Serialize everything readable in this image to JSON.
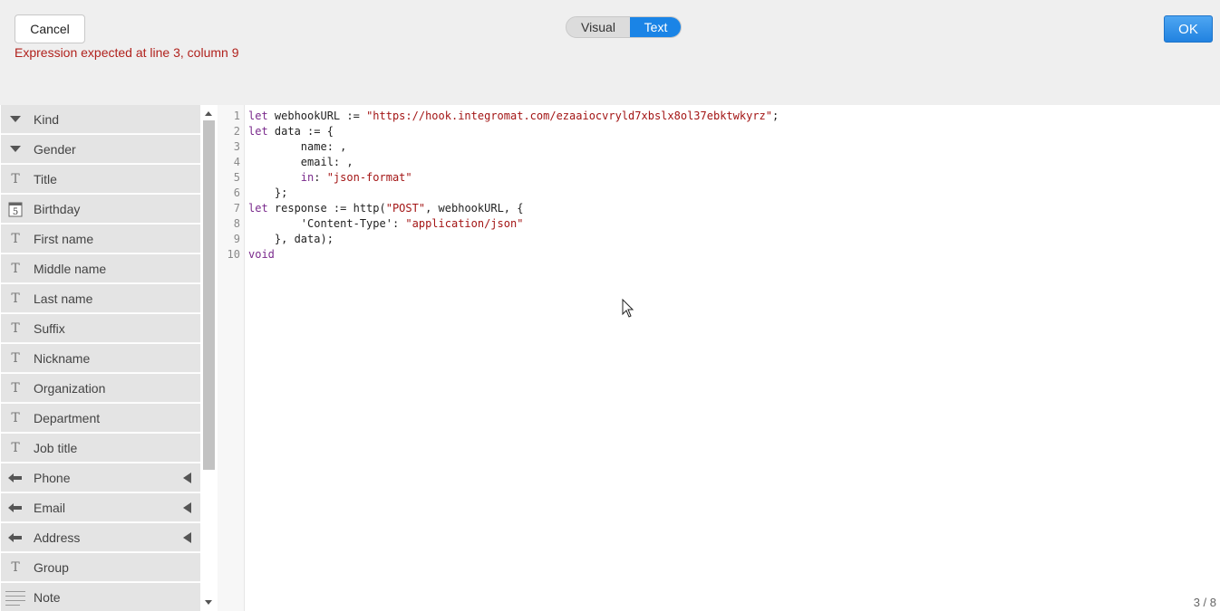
{
  "header": {
    "cancel_label": "Cancel",
    "error_message": "Expression expected at line 3, column 9",
    "toggle": {
      "visual_label": "Visual",
      "text_label": "Text",
      "active": "Text"
    },
    "ok_label": "OK"
  },
  "sidebar": {
    "items": [
      {
        "label": "Kind",
        "icon": "dropdown-icon"
      },
      {
        "label": "Gender",
        "icon": "dropdown-icon"
      },
      {
        "label": "Title",
        "icon": "text-icon"
      },
      {
        "label": "Birthday",
        "icon": "calendar-icon",
        "icon_text": "5"
      },
      {
        "label": "First name",
        "icon": "text-icon"
      },
      {
        "label": "Middle name",
        "icon": "text-icon"
      },
      {
        "label": "Last name",
        "icon": "text-icon"
      },
      {
        "label": "Suffix",
        "icon": "text-icon"
      },
      {
        "label": "Nickname",
        "icon": "text-icon"
      },
      {
        "label": "Organization",
        "icon": "text-icon"
      },
      {
        "label": "Department",
        "icon": "text-icon"
      },
      {
        "label": "Job title",
        "icon": "text-icon"
      },
      {
        "label": "Phone",
        "icon": "list-icon"
      },
      {
        "label": "Email",
        "icon": "list-icon"
      },
      {
        "label": "Address",
        "icon": "list-icon"
      },
      {
        "label": "Group",
        "icon": "text-icon"
      },
      {
        "label": "Note",
        "icon": "paragraph-icon"
      }
    ]
  },
  "editor": {
    "line_numbers": [
      "1",
      "2",
      "3",
      "4",
      "5",
      "6",
      "7",
      "8",
      "9",
      "10"
    ],
    "lines": [
      [
        {
          "t": "let",
          "c": "kw"
        },
        {
          "t": " webhookURL := "
        },
        {
          "t": "\"https://hook.integromat.com/ezaaiocvryld7xbslx8ol37ebktwkyrz\"",
          "c": "str"
        },
        {
          "t": ";"
        }
      ],
      [
        {
          "t": "let",
          "c": "kw"
        },
        {
          "t": " data := {"
        }
      ],
      [
        {
          "t": "        name: ,"
        }
      ],
      [
        {
          "t": "        email: ,"
        }
      ],
      [
        {
          "t": "        "
        },
        {
          "t": "in",
          "c": "prop"
        },
        {
          "t": ": "
        },
        {
          "t": "\"json-format\"",
          "c": "str"
        }
      ],
      [
        {
          "t": "    };"
        }
      ],
      [
        {
          "t": "let",
          "c": "kw"
        },
        {
          "t": " response := http("
        },
        {
          "t": "\"POST\"",
          "c": "str"
        },
        {
          "t": ", webhookURL, {"
        }
      ],
      [
        {
          "t": "        'Content-Type': "
        },
        {
          "t": "\"application/json\"",
          "c": "str"
        }
      ],
      [
        {
          "t": "    }, data);"
        }
      ],
      [
        {
          "t": "void",
          "c": "kw"
        }
      ]
    ],
    "page_counter": "3 / 8"
  }
}
